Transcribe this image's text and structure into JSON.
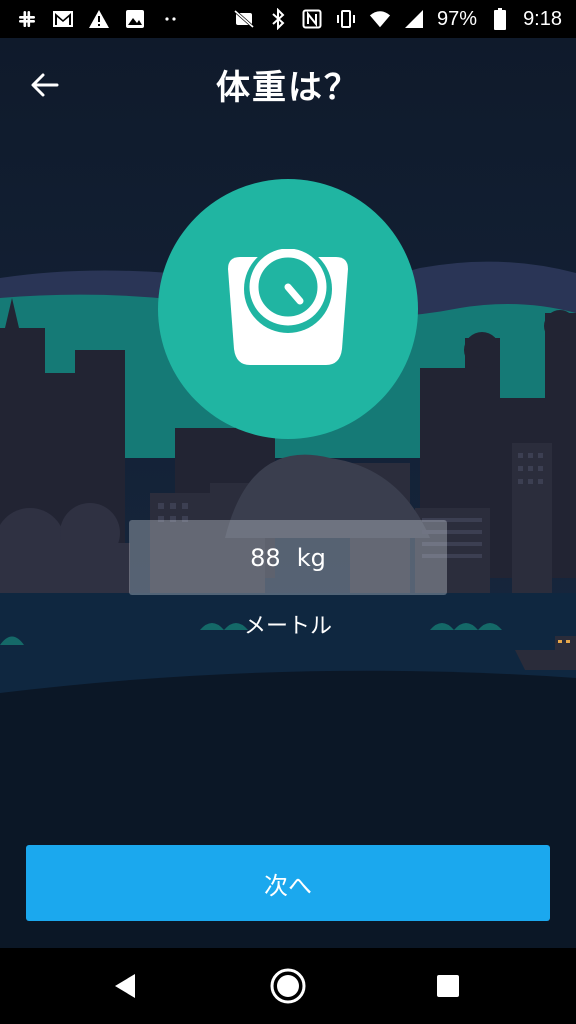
{
  "status_bar": {
    "battery": "97%",
    "time": "9:18",
    "icons_left": [
      "slack-icon",
      "gmail-icon",
      "warning-icon",
      "image-icon",
      "more-dots-icon"
    ],
    "icons_right": [
      "no-sim-icon",
      "bluetooth-icon",
      "nfc-icon",
      "vibrate-icon",
      "wifi-icon",
      "signal-icon",
      "battery-icon"
    ]
  },
  "header": {
    "title": "体重は？"
  },
  "weight_input": {
    "value": "88",
    "unit": "kg"
  },
  "unit_toggle_label": "メートル",
  "next_button_label": "次へ",
  "colors": {
    "accent_circle": "#20b5a2",
    "button": "#1ba8ee",
    "background": "#101a28"
  }
}
